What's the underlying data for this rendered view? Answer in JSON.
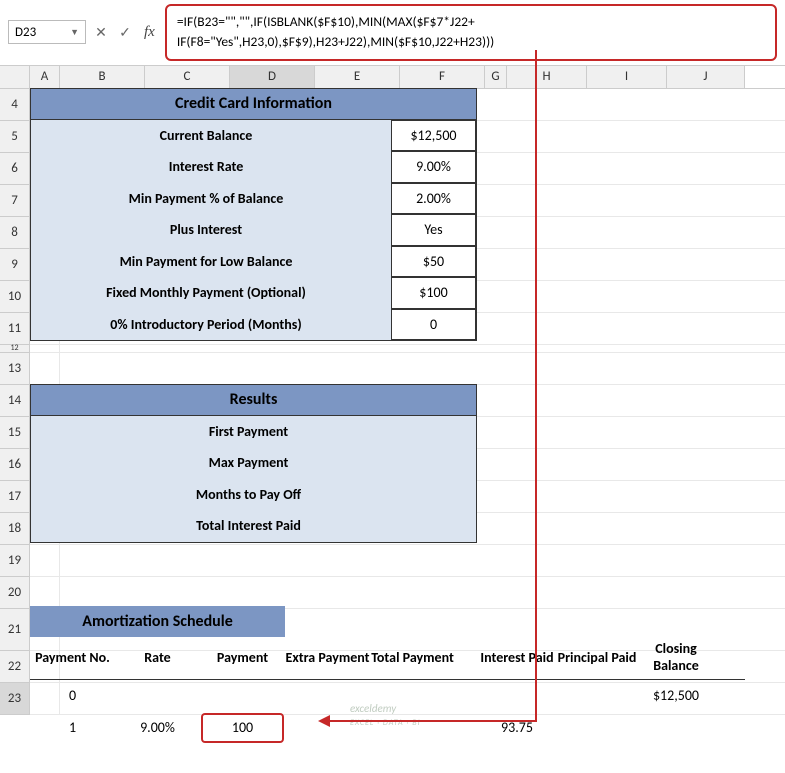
{
  "nameBox": "D23",
  "formula_line1": "=IF(B23=\"\",\"\",IF(ISBLANK($F$10),MIN(MAX($F$7*J22+",
  "formula_line2": "IF(F8=\"Yes\",H23,0),$F$9),H23+J22),MIN($F$10,J22+H23)))",
  "columns": [
    "A",
    "B",
    "C",
    "D",
    "E",
    "F",
    "G",
    "H",
    "I",
    "J"
  ],
  "section1": {
    "title": "Credit Card Information",
    "rows": [
      {
        "label": "Current Balance",
        "value": "$12,500"
      },
      {
        "label": "Interest Rate",
        "value": "9.00%"
      },
      {
        "label": "Min Payment % of Balance",
        "value": "2.00%"
      },
      {
        "label": "Plus Interest",
        "value": "Yes"
      },
      {
        "label": "Min Payment for Low Balance",
        "value": "$50"
      },
      {
        "label": "Fixed Monthly Payment (Optional)",
        "value": "$100"
      },
      {
        "label": "0% Introductory Period (Months)",
        "value": "0"
      }
    ]
  },
  "section2": {
    "title": "Results",
    "rows": [
      {
        "label": "First Payment"
      },
      {
        "label": "Max Payment"
      },
      {
        "label": "Months to Pay Off"
      },
      {
        "label": "Total Interest Paid"
      }
    ]
  },
  "amort": {
    "title": "Amortization Schedule",
    "headers": [
      "Payment No.",
      "Rate",
      "Payment",
      "Extra Payment",
      "Total Payment",
      "Interest Paid",
      "Principal Paid",
      "Closing Balance"
    ],
    "row22": {
      "no": "0",
      "closing": "$12,500"
    },
    "row23": {
      "no": "1",
      "rate": "9.00%",
      "payment": "100",
      "interest": "93.75"
    }
  },
  "watermark": {
    "main": "exceldemy",
    "sub": "EXCEL · DATA · BI"
  }
}
